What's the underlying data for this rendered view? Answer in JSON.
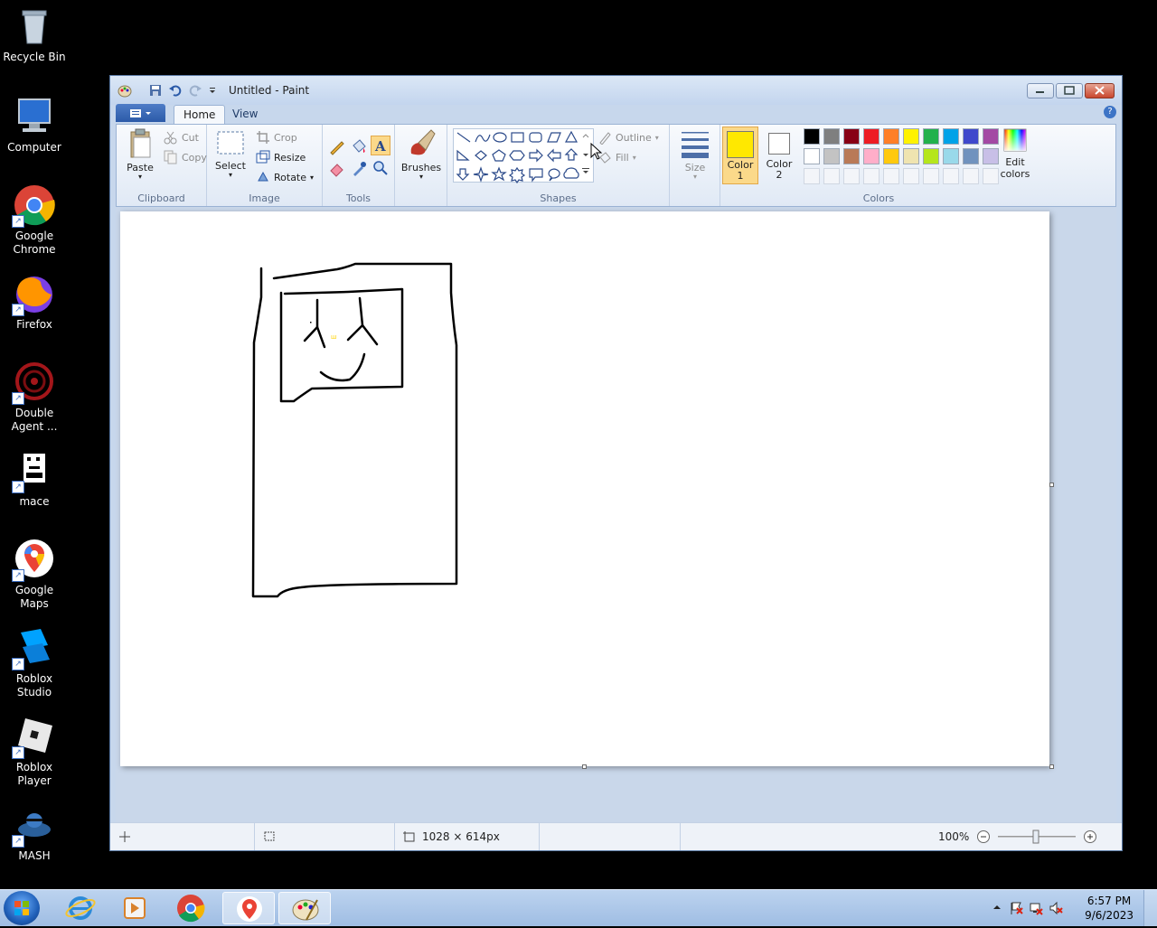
{
  "desktop": {
    "icons": [
      {
        "label": "Recycle Bin"
      },
      {
        "label": "Computer"
      },
      {
        "label": "Google Chrome"
      },
      {
        "label": "Firefox"
      },
      {
        "label": "Double Agent ..."
      },
      {
        "label": "mace"
      },
      {
        "label": "Google Maps"
      },
      {
        "label": "Roblox Studio"
      },
      {
        "label": "Roblox Player"
      },
      {
        "label": "MASH"
      }
    ]
  },
  "window": {
    "title": "Untitled - Paint"
  },
  "tabs": {
    "home": "Home",
    "view": "View"
  },
  "ribbon": {
    "clipboard": {
      "paste": "Paste",
      "cut": "Cut",
      "copy": "Copy",
      "group": "Clipboard"
    },
    "image": {
      "select": "Select",
      "crop": "Crop",
      "resize": "Resize",
      "rotate": "Rotate",
      "group": "Image"
    },
    "tools": {
      "group": "Tools"
    },
    "brushes": {
      "label": "Brushes"
    },
    "shapes": {
      "outline": "Outline",
      "fill": "Fill",
      "group": "Shapes"
    },
    "size": {
      "label": "Size"
    },
    "colors": {
      "color1": "Color",
      "color1_num": "1",
      "color2": "Color",
      "color2_num": "2",
      "edit": "Edit colors",
      "group": "Colors",
      "color1_value": "#ffe800",
      "color2_value": "#ffffff",
      "palette_row1": [
        "#000000",
        "#7f7f7f",
        "#880015",
        "#ed1c24",
        "#ff7f27",
        "#fff200",
        "#22b14c",
        "#00a2e8",
        "#3f48cc",
        "#a349a4"
      ],
      "palette_row2": [
        "#ffffff",
        "#c3c3c3",
        "#b97a57",
        "#ffaec9",
        "#ffc90e",
        "#efe4b0",
        "#b5e61d",
        "#99d9ea",
        "#7092be",
        "#c8bfe7"
      ]
    }
  },
  "statusbar": {
    "dimensions": "1028 × 614px",
    "zoom": "100%"
  },
  "taskbar": {
    "time": "6:57 PM",
    "date": "9/6/2023"
  }
}
